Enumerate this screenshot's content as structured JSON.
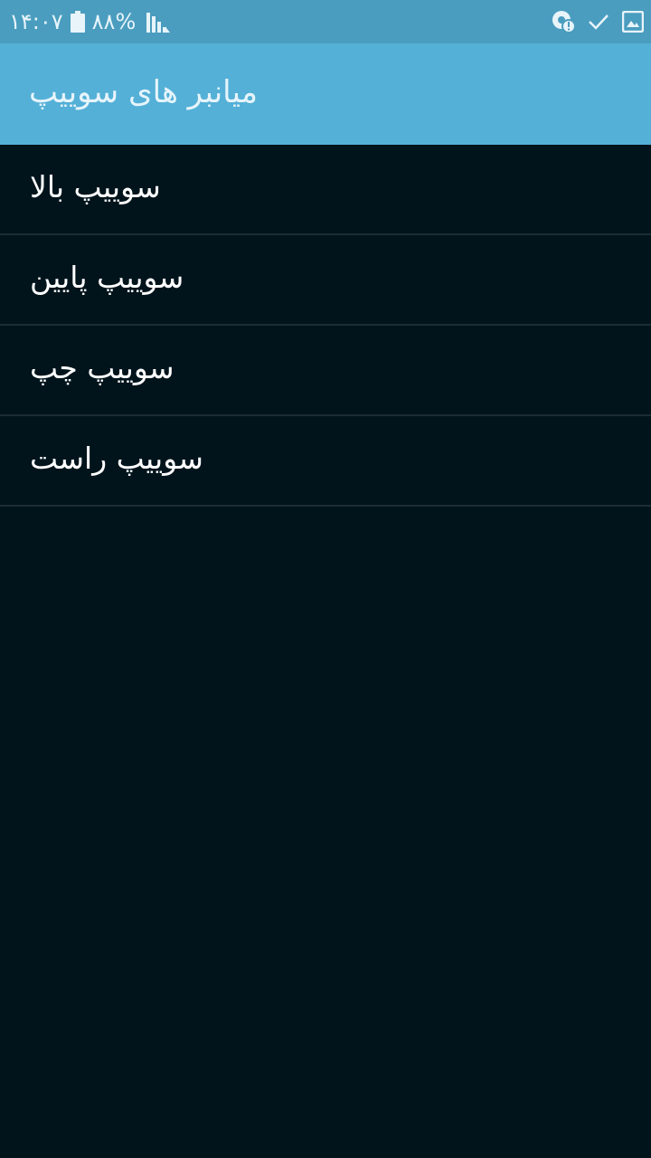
{
  "status_bar": {
    "time": "۱۴:۰۷",
    "battery_percent": "۸۸%",
    "battery_icon": "battery-icon",
    "signal_icon": "signal-icon",
    "right_icons": [
      "chrome-alert-icon",
      "check-icon",
      "gallery-icon"
    ],
    "background": "#4a9dbf"
  },
  "action_bar": {
    "title": "میانبر های سوییپ",
    "background": "#54b0d7"
  },
  "list": {
    "items": [
      {
        "label": "سوییپ بالا"
      },
      {
        "label": "سوییپ پایین"
      },
      {
        "label": "سوییپ چپ"
      },
      {
        "label": "سوییپ راست"
      }
    ]
  },
  "colors": {
    "page_background": "#01141c",
    "divider": "#1d2c33",
    "text": "#ffffff"
  }
}
